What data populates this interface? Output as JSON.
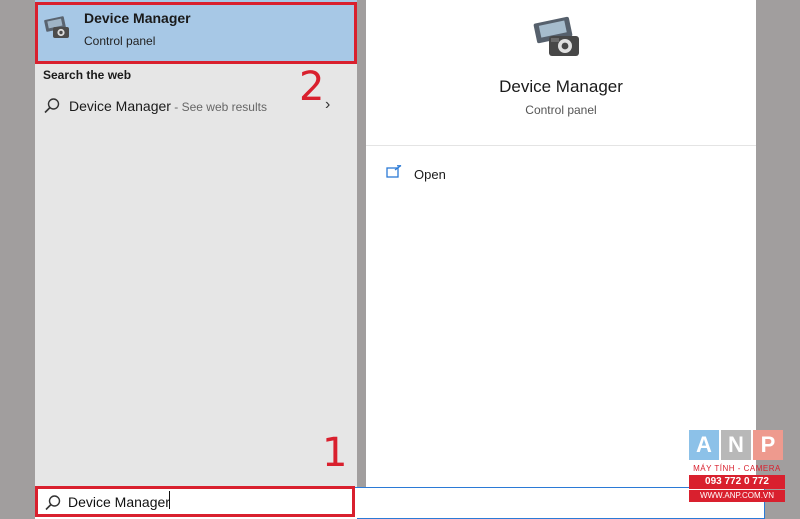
{
  "best_match": {
    "title": "Device Manager",
    "subtitle": "Control panel",
    "icon": "device-manager-icon"
  },
  "web_section": {
    "heading": "Search the web",
    "result_label": "Device Manager",
    "result_hint": " - See web results",
    "search_icon": "search-icon",
    "chevron": "chevron-right-icon"
  },
  "preview": {
    "title": "Device Manager",
    "subtitle": "Control panel",
    "icon": "device-manager-icon",
    "actions": [
      {
        "label": "Open",
        "icon": "open-window-icon"
      }
    ]
  },
  "search_box": {
    "value": "Device Manager",
    "icon": "search-icon"
  },
  "annotations": {
    "step_1": "1",
    "step_2": "2"
  },
  "watermark": {
    "letters": [
      "A",
      "N",
      "P"
    ],
    "line1": "MÁY TÍNH - CAMERA",
    "line2": "093 772 0 772",
    "line3": "WWW.ANP.COM.VN"
  },
  "colors": {
    "highlight": "#a7c8e6",
    "annotation_red": "#d9202e",
    "focus_blue": "#2b7ad6"
  }
}
